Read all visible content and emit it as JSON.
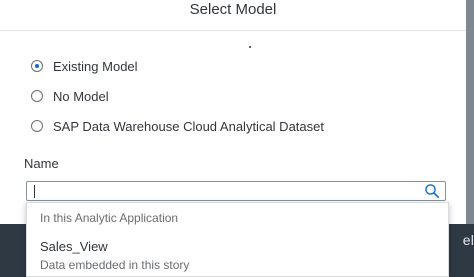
{
  "dialog": {
    "title": "Select Model"
  },
  "model_options": [
    {
      "label": "Existing Model",
      "selected": true
    },
    {
      "label": "No Model",
      "selected": false
    },
    {
      "label": "SAP Data Warehouse Cloud Analytical Dataset",
      "selected": false
    }
  ],
  "name_field": {
    "label": "Name",
    "value": "",
    "icon": "search-icon"
  },
  "dropdown": {
    "group_header": "In this Analytic Application",
    "items": [
      {
        "title": "Sales_View",
        "description": "Data embedded in this story"
      }
    ]
  },
  "background": {
    "partial_button_label": "el"
  },
  "colors": {
    "accent": "#0a6ed1",
    "text": "#32363a",
    "muted_text": "#6a6d70",
    "backdrop": "#2f3944"
  }
}
